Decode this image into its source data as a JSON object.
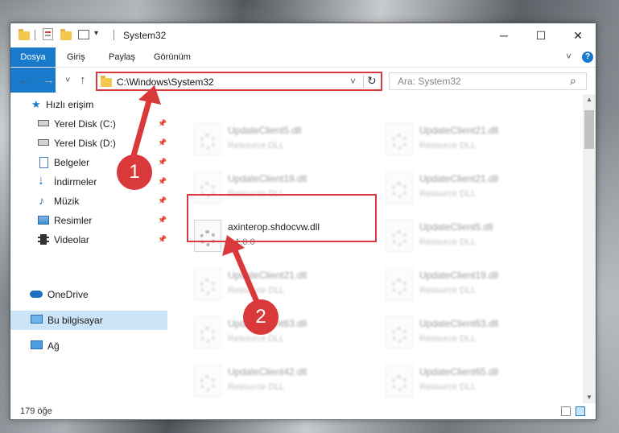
{
  "window": {
    "title": "System32",
    "minimize_glyph": "─",
    "maximize_glyph": "☐",
    "close_glyph": "✕"
  },
  "ribbon": {
    "tabs": [
      "Dosya",
      "Giriş",
      "Paylaş",
      "Görünüm"
    ],
    "expand_glyph": "˅",
    "help_glyph": "?"
  },
  "nav": {
    "back_glyph": "←",
    "forward_glyph": "→",
    "recent_glyph": "˅",
    "up_glyph": "↑",
    "address": "C:\\Windows\\System32",
    "dropdown_glyph": "˅",
    "refresh_glyph": "↻",
    "search_placeholder": "Ara: System32",
    "search_glyph": "⌕"
  },
  "sidebar": {
    "items": [
      {
        "label": "Hızlı erişim",
        "icon": "star-icon",
        "pinned": false
      },
      {
        "label": "Yerel Disk (C:)",
        "icon": "drive-icon",
        "pinned": true
      },
      {
        "label": "Yerel Disk (D:)",
        "icon": "drive-icon",
        "pinned": true
      },
      {
        "label": "Belgeler",
        "icon": "documents-icon",
        "pinned": true
      },
      {
        "label": "İndirmeler",
        "icon": "download-icon",
        "pinned": true
      },
      {
        "label": "Müzik",
        "icon": "music-icon",
        "pinned": true
      },
      {
        "label": "Resimler",
        "icon": "pictures-icon",
        "pinned": true
      },
      {
        "label": "Videolar",
        "icon": "video-icon",
        "pinned": true
      },
      {
        "label": "OneDrive",
        "icon": "cloud-icon",
        "pinned": false
      },
      {
        "label": "Bu bilgisayar",
        "icon": "computer-icon",
        "pinned": false,
        "selected": true
      },
      {
        "label": "Ağ",
        "icon": "network-icon",
        "pinned": false
      }
    ],
    "pin_glyph": "📌"
  },
  "files": {
    "left": [
      {
        "name": "UpdateClient5.dll",
        "type": "Resource DLL"
      },
      {
        "name": "UpdateClient19.dll",
        "type": "Resource DLL"
      },
      {
        "name": "axinterop.shdocvw.dll",
        "type": "1.1.0.0"
      },
      {
        "name": "UpdateClient21.dll",
        "type": "Resource DLL"
      },
      {
        "name": "UpdateClient63.dll",
        "type": "Resource DLL"
      },
      {
        "name": "UpdateClient42.dll",
        "type": "Resource DLL"
      }
    ],
    "right": [
      {
        "name": "UpdateClient21.dll",
        "type": "Resource DLL"
      },
      {
        "name": "UpdateClient21.dll",
        "type": "Resource DLL"
      },
      {
        "name": "UpdateClient5.dll",
        "type": "Resource DLL"
      },
      {
        "name": "UpdateClient19.dll",
        "type": "Resource DLL"
      },
      {
        "name": "UpdateClient63.dll",
        "type": "Resource DLL"
      },
      {
        "name": "UpdateClient65.dll",
        "type": "Resource DLL"
      }
    ]
  },
  "status": {
    "count": "179 öğe"
  },
  "callouts": [
    "1",
    "2"
  ],
  "colors": {
    "accent": "#1979ca",
    "highlight": "#d9393a",
    "selected": "#cce4f7"
  }
}
